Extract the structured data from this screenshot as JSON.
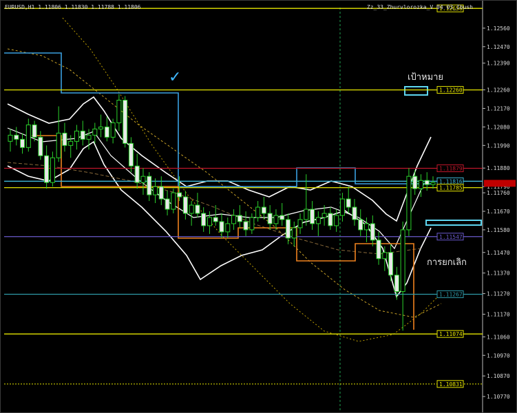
{
  "header": {
    "symbol_timeframe": "EURUSD,H1",
    "ohlc": "1.11806 1.11830 1.11788 1.11806",
    "indicator_label": "Zz_33_Zhurvlorozka_V 04 03_Ibush"
  },
  "annotations": {
    "target_label": "เป้าหมาย",
    "cancel_label": "การยกเลิก"
  },
  "chart_data": {
    "type": "candlestick",
    "symbol": "EURUSD",
    "timeframe": "H1",
    "y_ticks": [
      1.1256,
      1.1247,
      1.1239,
      1.1226,
      1.1217,
      1.1208,
      1.1199,
      1.1188,
      1.1179,
      1.1176,
      1.1167,
      1.1158,
      1.1147,
      1.1137,
      1.1127,
      1.1117,
      1.1106,
      1.1097,
      1.1087,
      1.1077
    ],
    "y_tick_labels": [
      "1.12560",
      "1.12470",
      "1.12390",
      "1.12260",
      "1.12170",
      "1.12080",
      "1.11990",
      "1.11880",
      "1.11790",
      "1.11760",
      "1.11670",
      "1.11580",
      "1.11470",
      "1.11370",
      "1.11270",
      "1.11170",
      "1.11060",
      "1.10970",
      "1.10870",
      "1.10770"
    ],
    "price_levels": [
      {
        "label": "1.12656",
        "value": 1.12656,
        "color": "#e6e600",
        "style": "solid"
      },
      {
        "label": "1.12260",
        "value": 1.1226,
        "color": "#e6e600",
        "style": "solid"
      },
      {
        "label": "1.11879",
        "value": 1.11879,
        "color": "#c0172a",
        "style": "solid"
      },
      {
        "label": "1.11816",
        "value": 1.11816,
        "color": "#3fb8d8",
        "style": "solid"
      },
      {
        "label": "1.11785",
        "value": 1.11785,
        "color": "#e6e600",
        "style": "solid"
      },
      {
        "label": "1.11547",
        "value": 1.11547,
        "color": "#6a5acd",
        "style": "solid"
      },
      {
        "label": "1.11267",
        "value": 1.11267,
        "color": "#2e9aa8",
        "style": "solid"
      },
      {
        "label": "1.11074",
        "value": 1.11074,
        "color": "#e6e600",
        "style": "solid"
      },
      {
        "label": "1.10831",
        "value": 1.10831,
        "color": "#e6e600",
        "style": "dotted"
      }
    ],
    "target_level_label": "1.12264",
    "current_price": 1.11806,
    "candles": [
      [
        1.1201,
        1.1207,
        1.1196,
        1.1204
      ],
      [
        1.1204,
        1.1208,
        1.1199,
        1.1202
      ],
      [
        1.1202,
        1.1205,
        1.1195,
        1.1198
      ],
      [
        1.1198,
        1.1212,
        1.1196,
        1.1209
      ],
      [
        1.1209,
        1.1211,
        1.1201,
        1.1203
      ],
      [
        1.1203,
        1.1206,
        1.1192,
        1.1194
      ],
      [
        1.1194,
        1.1199,
        1.1178,
        1.1181
      ],
      [
        1.1181,
        1.1196,
        1.1179,
        1.1193
      ],
      [
        1.1193,
        1.1218,
        1.1191,
        1.1205
      ],
      [
        1.1205,
        1.121,
        1.1196,
        1.1199
      ],
      [
        1.1199,
        1.1204,
        1.1193,
        1.1201
      ],
      [
        1.1201,
        1.1209,
        1.1197,
        1.1206
      ],
      [
        1.1206,
        1.1211,
        1.1199,
        1.1202
      ],
      [
        1.1202,
        1.1207,
        1.1197,
        1.1204
      ],
      [
        1.1204,
        1.121,
        1.12,
        1.1207
      ],
      [
        1.1207,
        1.1214,
        1.1203,
        1.1208
      ],
      [
        1.1208,
        1.1213,
        1.1201,
        1.1203
      ],
      [
        1.1203,
        1.1212,
        1.12,
        1.121
      ],
      [
        1.121,
        1.1224,
        1.1206,
        1.1221
      ],
      [
        1.1221,
        1.1223,
        1.1198,
        1.12
      ],
      [
        1.12,
        1.1203,
        1.1186,
        1.1189
      ],
      [
        1.1189,
        1.1195,
        1.1178,
        1.1181
      ],
      [
        1.1181,
        1.1188,
        1.1175,
        1.1184
      ],
      [
        1.1184,
        1.1186,
        1.1172,
        1.1175
      ],
      [
        1.1175,
        1.1183,
        1.1171,
        1.1179
      ],
      [
        1.1179,
        1.1184,
        1.117,
        1.1173
      ],
      [
        1.1173,
        1.1177,
        1.1165,
        1.1168
      ],
      [
        1.1168,
        1.1178,
        1.1166,
        1.1176
      ],
      [
        1.1176,
        1.1184,
        1.1172,
        1.1174
      ],
      [
        1.1174,
        1.1177,
        1.1163,
        1.1166
      ],
      [
        1.1166,
        1.1172,
        1.116,
        1.117
      ],
      [
        1.117,
        1.1176,
        1.1164,
        1.1166
      ],
      [
        1.1166,
        1.1169,
        1.1157,
        1.116
      ],
      [
        1.116,
        1.1167,
        1.1156,
        1.1164
      ],
      [
        1.1164,
        1.117,
        1.116,
        1.1162
      ],
      [
        1.1162,
        1.1166,
        1.1154,
        1.1157
      ],
      [
        1.1157,
        1.1164,
        1.1154,
        1.1161
      ],
      [
        1.1161,
        1.1168,
        1.1158,
        1.1165
      ],
      [
        1.1165,
        1.117,
        1.1159,
        1.1162
      ],
      [
        1.1162,
        1.1167,
        1.1155,
        1.1158
      ],
      [
        1.1158,
        1.1166,
        1.1156,
        1.1164
      ],
      [
        1.1164,
        1.1172,
        1.1162,
        1.1169
      ],
      [
        1.1169,
        1.1174,
        1.1163,
        1.1166
      ],
      [
        1.1166,
        1.117,
        1.1158,
        1.1161
      ],
      [
        1.1161,
        1.1168,
        1.1158,
        1.1165
      ],
      [
        1.1165,
        1.1171,
        1.116,
        1.1163
      ],
      [
        1.1163,
        1.1166,
        1.1151,
        1.1154
      ],
      [
        1.1154,
        1.1162,
        1.115,
        1.1159
      ],
      [
        1.1159,
        1.1166,
        1.1156,
        1.1163
      ],
      [
        1.1163,
        1.1185,
        1.116,
        1.1168
      ],
      [
        1.1168,
        1.1172,
        1.1158,
        1.1161
      ],
      [
        1.1161,
        1.1167,
        1.1155,
        1.1164
      ],
      [
        1.1164,
        1.117,
        1.116,
        1.1166
      ],
      [
        1.1166,
        1.1169,
        1.1158,
        1.116
      ],
      [
        1.116,
        1.1168,
        1.1157,
        1.1165
      ],
      [
        1.1165,
        1.1176,
        1.1162,
        1.1173
      ],
      [
        1.1173,
        1.1179,
        1.1166,
        1.1169
      ],
      [
        1.1169,
        1.1173,
        1.116,
        1.1163
      ],
      [
        1.1163,
        1.1168,
        1.1155,
        1.1158
      ],
      [
        1.1158,
        1.1164,
        1.1152,
        1.1161
      ],
      [
        1.1161,
        1.1165,
        1.115,
        1.1153
      ],
      [
        1.1153,
        1.1157,
        1.1141,
        1.1144
      ],
      [
        1.1144,
        1.115,
        1.1138,
        1.1147
      ],
      [
        1.1147,
        1.1151,
        1.1133,
        1.1136
      ],
      [
        1.1136,
        1.114,
        1.1124,
        1.1128
      ],
      [
        1.1128,
        1.1162,
        1.1109,
        1.1158
      ],
      [
        1.1158,
        1.1188,
        1.1155,
        1.1184
      ],
      [
        1.1184,
        1.1187,
        1.1175,
        1.1178
      ],
      [
        1.1178,
        1.1185,
        1.1174,
        1.1182
      ],
      [
        1.1182,
        1.1186,
        1.1177,
        1.118
      ],
      [
        1.118,
        1.1184,
        1.1178,
        1.1181
      ]
    ]
  }
}
